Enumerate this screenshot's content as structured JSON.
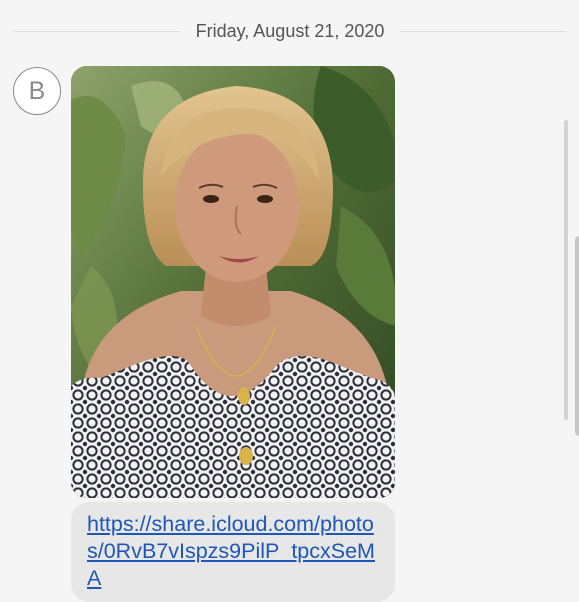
{
  "conversation": {
    "date_header": "Friday, August 21, 2020",
    "sender_initial": "B",
    "messages": [
      {
        "type": "image",
        "description": "photo-of-woman"
      },
      {
        "type": "link",
        "text": "https://share.icloud.com/photos/0RvB7vIspzs9PilP_tpcxSeMA"
      }
    ]
  }
}
